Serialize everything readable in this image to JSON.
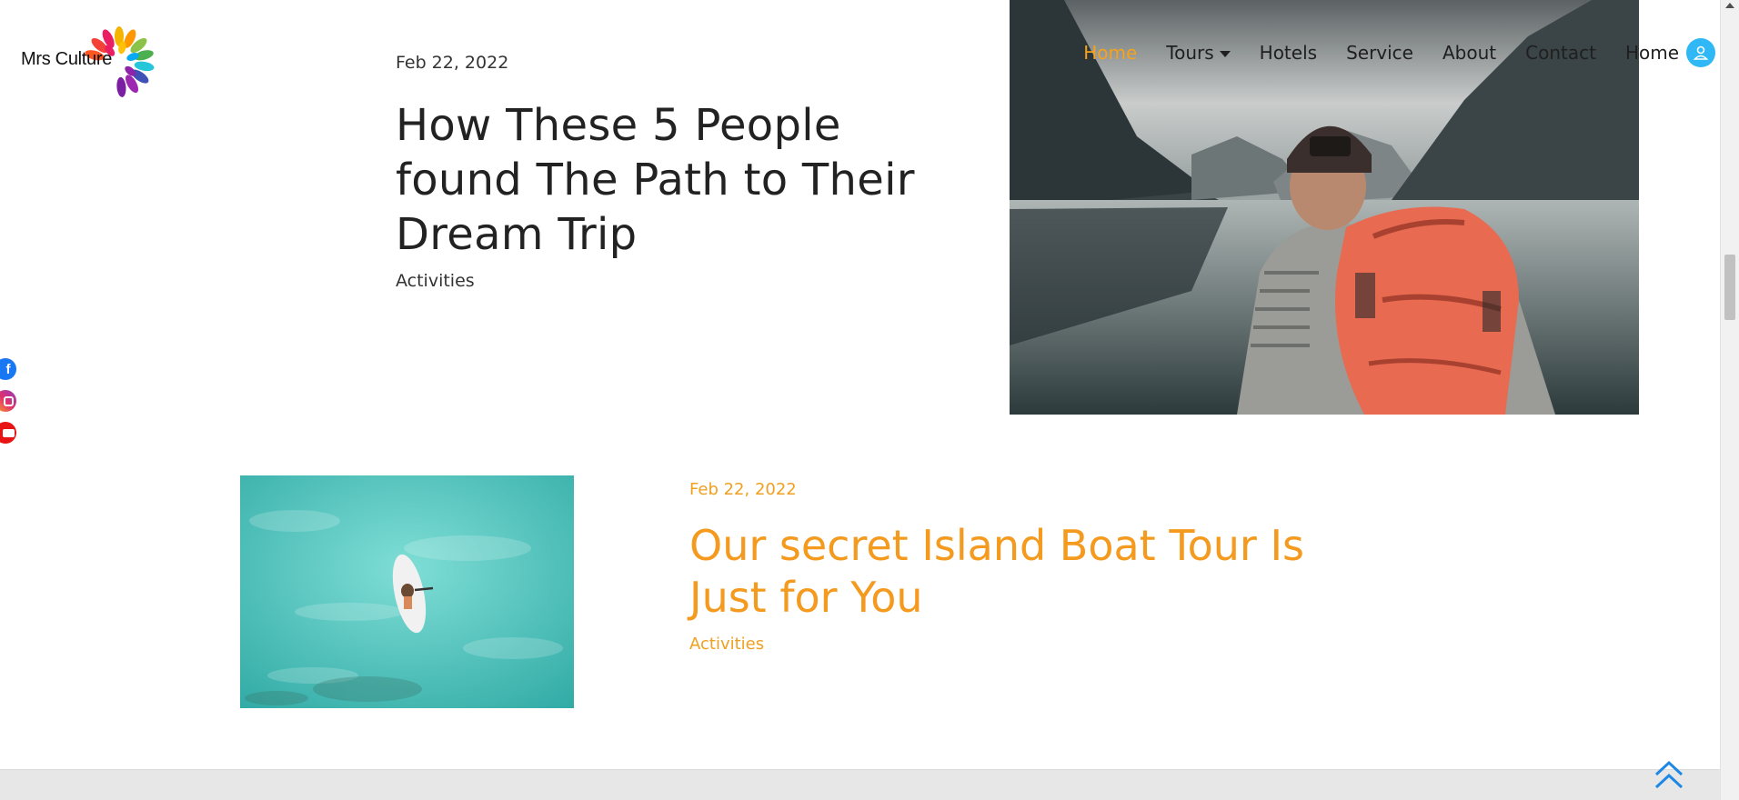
{
  "brand": {
    "name": "Mrs Culture"
  },
  "nav": {
    "items": [
      {
        "label": "Home",
        "active": true
      },
      {
        "label": "Tours",
        "dropdown": true
      },
      {
        "label": "Hotels"
      },
      {
        "label": "Service"
      },
      {
        "label": "About"
      },
      {
        "label": "Contact"
      },
      {
        "label": "Home"
      }
    ],
    "user_icon": "user-icon"
  },
  "posts": [
    {
      "date": "Feb 22, 2022",
      "title": "How These 5 People found The Path to Their Dream Trip",
      "category": "Activities",
      "image": "hiker-lake-photo"
    },
    {
      "date": "Feb 22, 2022",
      "title": "Our secret Island Boat Tour Is Just for You",
      "category": "Activities",
      "image": "paddleboard-turquoise-water-photo"
    }
  ],
  "social": [
    "facebook-icon",
    "instagram-icon",
    "youtube-icon"
  ],
  "colors": {
    "accent": "#f39a1f",
    "user_button": "#2fb8f5",
    "text": "#222222"
  }
}
